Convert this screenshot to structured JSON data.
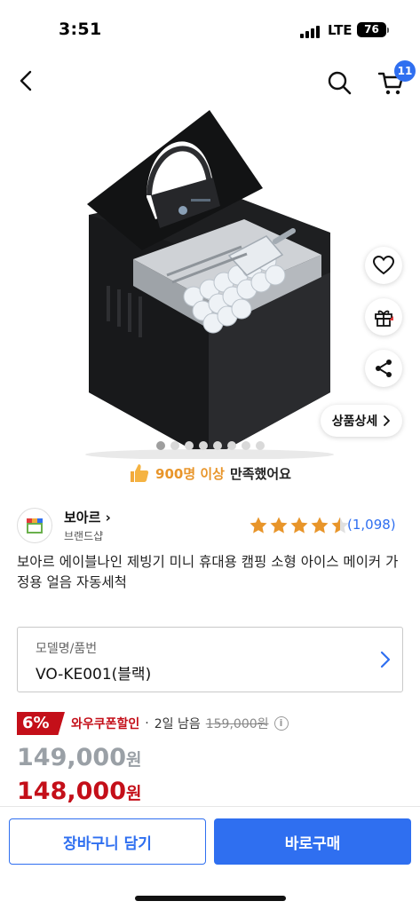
{
  "status_bar": {
    "time": "3:51",
    "network": "LTE",
    "battery": "76"
  },
  "header": {
    "cart_count": "11"
  },
  "carousel": {
    "total": 8,
    "active_index": 0
  },
  "side_actions": {
    "detail_label": "상품상세"
  },
  "satisfaction": {
    "highlight": "900명 이상",
    "text": "만족했어요"
  },
  "brand": {
    "name": "보아르",
    "sub": "브랜드샵"
  },
  "rating": {
    "stars": 4.5,
    "review_count": "(1,098)"
  },
  "product": {
    "title": "보아르 에이블나인 제빙기 미니 휴대용 캠핑 소형 아이스 메이커 가정용 얼음 자동세척"
  },
  "option": {
    "label": "모델명/품번",
    "value": "VO-KE001(블랙)"
  },
  "price": {
    "discount": "6%",
    "coupon_label": "와우쿠폰할인",
    "separator": "·",
    "remaining": "2일 남음",
    "original": "159,000원",
    "sale_value": "149,000",
    "final_value": "148,000",
    "unit": "원"
  },
  "buttons": {
    "add_to_cart": "장바구니 담기",
    "buy_now": "바로구매"
  },
  "colors": {
    "accent": "#2f6ff0",
    "sale": "#c40f19",
    "gold": "#e8952a"
  }
}
